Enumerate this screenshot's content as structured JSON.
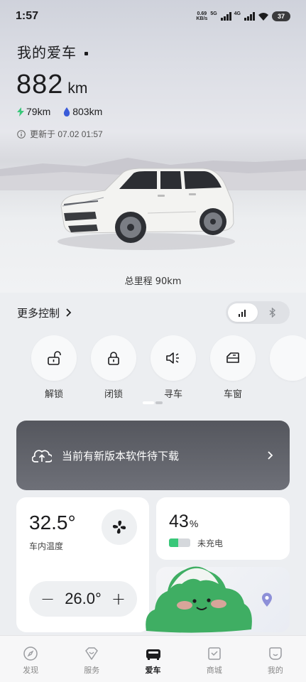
{
  "status_bar": {
    "time": "1:57",
    "net_speed_value": "0.69",
    "net_speed_unit": "KB/s",
    "sim1_label": "5G",
    "sim2_label": "4G",
    "battery": "37"
  },
  "header": {
    "title": "我的爱车"
  },
  "range": {
    "total": "882",
    "unit": "km",
    "electric": "79km",
    "fuel": "803km",
    "updated": "更新于 07.02 01:57"
  },
  "odometer": "总里程 90km",
  "more_controls": {
    "label": "更多控制",
    "mode_cellular_icon": "signal-bars-icon",
    "mode_bluetooth_icon": "bluetooth-icon"
  },
  "controls": [
    {
      "label": "解锁",
      "icon": "unlock-icon"
    },
    {
      "label": "闭锁",
      "icon": "lock-icon"
    },
    {
      "label": "寻车",
      "icon": "horn-icon"
    },
    {
      "label": "车窗",
      "icon": "window-icon"
    }
  ],
  "software_update": {
    "text": "当前有新版本软件待下载"
  },
  "climate": {
    "inside_temp": "32.5°",
    "inside_label": "车内温度",
    "set_temp": "26.0°",
    "minus": "−",
    "plus": "+"
  },
  "battery_card": {
    "percent_value": "43",
    "percent_unit": "%",
    "status": "未充电",
    "level": 0.43
  },
  "tabbar": [
    {
      "label": "发现",
      "icon": "compass-icon",
      "active": false
    },
    {
      "label": "服务",
      "icon": "service-heart-icon",
      "active": false
    },
    {
      "label": "爱车",
      "icon": "car-icon",
      "active": true
    },
    {
      "label": "商城",
      "icon": "shop-bag-icon",
      "active": false
    },
    {
      "label": "我的",
      "icon": "profile-icon",
      "active": false
    }
  ],
  "colors": {
    "electric_green": "#39c779",
    "fuel_blue": "#3a5bd9",
    "update_card": "#5e6068",
    "sticker_green": "#3fae63"
  }
}
